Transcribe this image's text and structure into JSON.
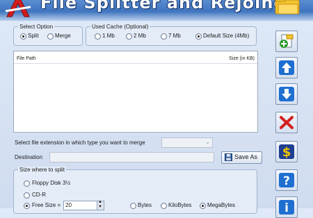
{
  "app": {
    "title": "File Splitter and Rejoiner"
  },
  "select_option": {
    "legend": "Select Option",
    "options": [
      {
        "label": "Split",
        "selected": true
      },
      {
        "label": "Merge",
        "selected": false
      }
    ]
  },
  "used_cache": {
    "legend": "Used Cache (Optional)",
    "options": [
      {
        "label": "1 Mb",
        "selected": false
      },
      {
        "label": "2 Mb",
        "selected": false
      },
      {
        "label": "7 Mb",
        "selected": false
      },
      {
        "label": "Default Size (4Mb)",
        "selected": true
      }
    ]
  },
  "file_table": {
    "columns": [
      "File Path",
      "Size (in KB)"
    ],
    "rows": []
  },
  "merge_extension": {
    "label": "Select file extension in which type you want to merge",
    "value": ""
  },
  "destination": {
    "label": "Destination",
    "value": "",
    "save_label": "Save As"
  },
  "split_size": {
    "legend": "Size where to split",
    "options": [
      {
        "label": "Floppy Disk 3½",
        "selected": false
      },
      {
        "label": "CD-R",
        "selected": false
      },
      {
        "label": "Free Size =",
        "selected": true
      }
    ],
    "free_size_value": "20",
    "units": [
      {
        "label": "Bytes",
        "selected": false
      },
      {
        "label": "KiloBytes",
        "selected": false
      },
      {
        "label": "MegaBytes",
        "selected": true
      }
    ]
  },
  "side_buttons": [
    "add-file",
    "move-up",
    "move-down",
    "remove",
    "buy",
    "help",
    "info"
  ],
  "colors": {
    "header": "#4a80c8",
    "add": "#2e9a2e",
    "arrow": "#1f6fd1",
    "remove": "#d22020",
    "dollar": "#f2c200",
    "background": "#d6e2f3"
  }
}
